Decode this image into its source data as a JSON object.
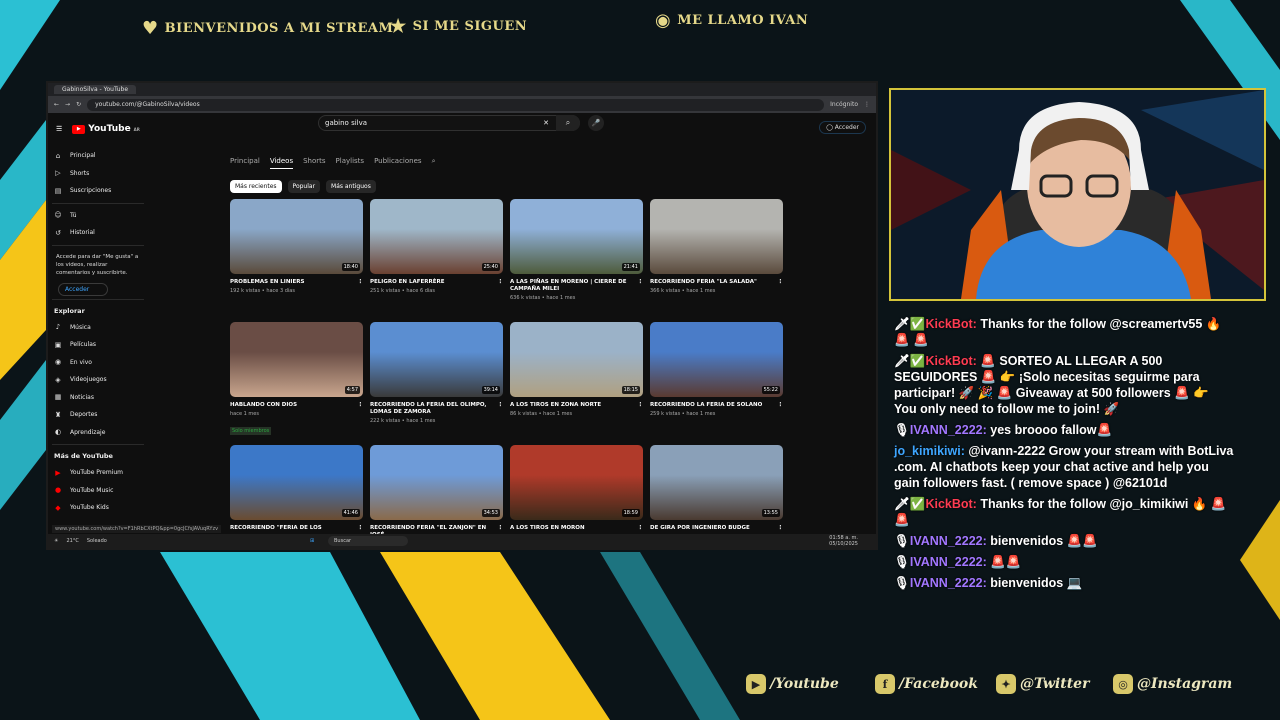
{
  "overlay": {
    "banner1": "Bienvenidos a mi stream",
    "banner2": "Si me siguen",
    "banner3": "Me llamo Ivan",
    "socials": [
      "/Youtube",
      "/Facebook",
      "@Twitter",
      "@Instagram"
    ]
  },
  "browser": {
    "tab_title": "GabinoSilva - YouTube",
    "url": "youtube.com/@GabinoSilva/videos",
    "incognito": "Incógnito",
    "status_url": "www.youtube.com/watch?v=F1hRbCXtPQ&pp=0gcJCfsJAVuqRYzv"
  },
  "youtube": {
    "logo": "YouTube",
    "country": "AR",
    "search_value": "gabino silva",
    "signin": "Acceder",
    "sidebar": {
      "items1": [
        "Principal",
        "Shorts",
        "Suscripciones"
      ],
      "items2": [
        "Tú",
        "Historial"
      ],
      "note": "Accede para dar \"Me gusta\" a los videos, realizar comentarios y suscribirte.",
      "signin": "Acceder",
      "explore_title": "Explorar",
      "explore": [
        "Música",
        "Películas",
        "En vivo",
        "Videojuegos",
        "Noticias",
        "Deportes",
        "Aprendizaje"
      ],
      "more_title": "Más de YouTube",
      "more": [
        "YouTube Premium",
        "YouTube Music",
        "YouTube Kids"
      ]
    },
    "tabs": [
      "Principal",
      "Videos",
      "Shorts",
      "Playlists",
      "Publicaciones"
    ],
    "chips": [
      "Más recientes",
      "Popular",
      "Más antiguos"
    ],
    "videos": [
      {
        "title": "PROBLEMAS EN LINIERS",
        "meta": "192 k vistas • hace 3 días",
        "dur": "18:40",
        "c1": "#8aa7c8",
        "c2": "#5a4a3a"
      },
      {
        "title": "PELIGRO EN LAFERRÈRE",
        "meta": "251 k vistas • hace 6 días",
        "dur": "25:40",
        "c1": "#9fb7c9",
        "c2": "#6a4030"
      },
      {
        "title": "A LAS PIÑAS EN MORENO | CIERRE DE CAMPAÑA MILEI",
        "meta": "636 k vistas • hace 1 mes",
        "dur": "21:41",
        "c1": "#8fb0d8",
        "c2": "#4e5b3b"
      },
      {
        "title": "RECORRIENDO FERIA \"LA SALADA\"",
        "meta": "366 k vistas • hace 1 mes",
        "dur": "",
        "c1": "#b4b4b0",
        "c2": "#5a4a3c"
      },
      {
        "title": "HABLANDO CON DIOS",
        "meta": "hace 1 mes",
        "badge": "Solo miembros",
        "dur": "4:57",
        "c1": "#6a4d45",
        "c2": "#c9a68e"
      },
      {
        "title": "RECORRIENDO LA FERIA DEL OLIMPO, LOMAS DE ZAMORA",
        "meta": "222 k vistas • hace 1 mes",
        "dur": "39:14",
        "c1": "#5b8ed1",
        "c2": "#3a3a3a"
      },
      {
        "title": "A LOS TIROS EN ZONA NORTE",
        "meta": "86 k vistas • hace 1 mes",
        "dur": "18:15",
        "c1": "#9bb2c8",
        "c2": "#b0a080"
      },
      {
        "title": "RECORRIENDO LA FERIA DE SOLANO",
        "meta": "259 k vistas • hace 1 mes",
        "dur": "55:22",
        "c1": "#4a7cc8",
        "c2": "#5a3a30"
      },
      {
        "title": "RECORRIENDO \"FERIA DE LOS",
        "meta": "",
        "dur": "41:46",
        "c1": "#3c78c8",
        "c2": "#6a4c30"
      },
      {
        "title": "RECORRIENDO FERIA \"EL ZANJON\" EN JOSÉ",
        "meta": "",
        "dur": "34:53",
        "c1": "#6e9bd8",
        "c2": "#8a6a4a"
      },
      {
        "title": "A LOS TIROS EN MORON",
        "meta": "",
        "dur": "18:59",
        "c1": "#b03a2a",
        "c2": "#3a2a1a"
      },
      {
        "title": "DE GIRA POR INGENIERO BUDGE",
        "meta": "",
        "dur": "13:55",
        "c1": "#8aa0b8",
        "c2": "#4a3a30"
      }
    ]
  },
  "taskbar": {
    "temp": "21°C",
    "weather": "Soleado",
    "search": "Buscar",
    "time": "01:58 a. m.",
    "date": "05/10/2025"
  },
  "chat": [
    {
      "user": "KickBot:",
      "cls": "u-bot",
      "pre": "🗡✅",
      "text": "Thanks for the follow @screamertv55 🔥 🚨 🚨"
    },
    {
      "user": "KickBot:",
      "cls": "u-bot",
      "pre": "🗡✅",
      "text": "🚨 SORTEO AL LLEGAR A 500 SEGUIDORES 🚨 👉 ¡Solo necesitas seguirme para participar! 🚀 🎉 🚨 Giveaway at 500 followers 🚨 👉 You only need to follow me to join! 🚀"
    },
    {
      "user": "IVANN_2222:",
      "cls": "u-ivan",
      "pre": "🎙",
      "text": "yes broooo fallow🚨"
    },
    {
      "user": "jo_kimikiwi:",
      "cls": "u-kimi",
      "pre": "",
      "text": "@ivann-2222 Grow your stream with BotLiva .com. AI chatbots keep your chat active and help you gain followers fast. ( remove space ) @62101d"
    },
    {
      "user": "KickBot:",
      "cls": "u-bot",
      "pre": "🗡✅",
      "text": "Thanks for the follow @jo_kimikiwi 🔥 🚨 🚨"
    },
    {
      "user": "IVANN_2222:",
      "cls": "u-ivan",
      "pre": "🎙",
      "text": "bienvenidos 🚨🚨"
    },
    {
      "user": "IVANN_2222:",
      "cls": "u-ivan",
      "pre": "🎙",
      "text": "🚨🚨"
    },
    {
      "user": "IVANN_2222:",
      "cls": "u-ivan",
      "pre": "🎙",
      "text": "bienvenidos 💻"
    }
  ],
  "colors": {
    "accent_yellow": "#f5c518",
    "accent_cyan": "#2fd3e8",
    "chat_bot": "#ff3c52",
    "chat_ivan": "#a277ff"
  }
}
